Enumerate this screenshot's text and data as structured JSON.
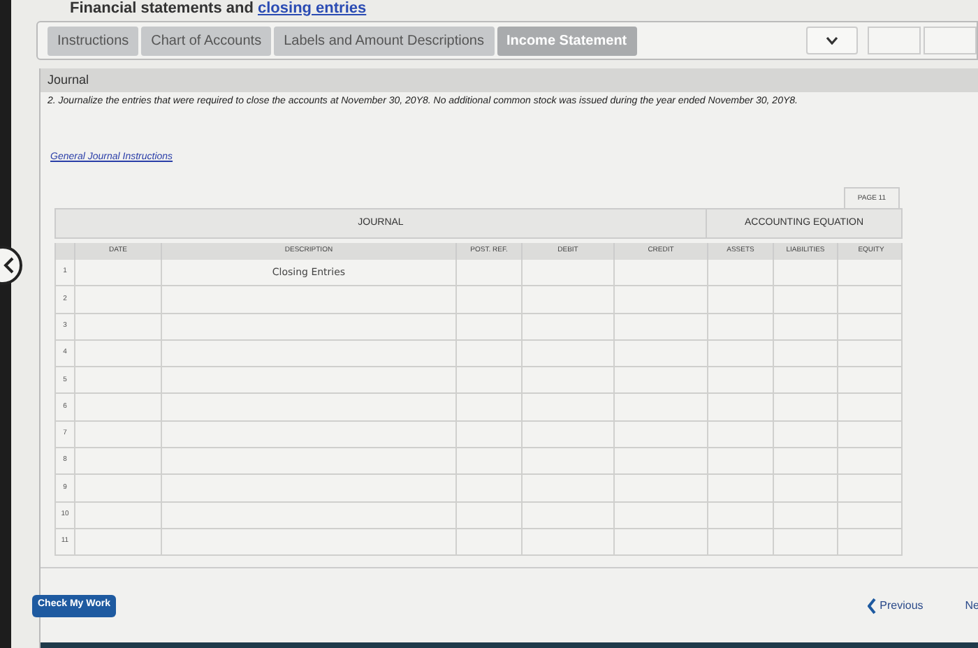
{
  "header": {
    "title": "Financial statements and",
    "link": "closing entries"
  },
  "tabs": [
    {
      "label": "Instructions",
      "selected": false
    },
    {
      "label": "Chart of Accounts",
      "selected": false
    },
    {
      "label": "Labels and Amount Descriptions",
      "selected": false
    },
    {
      "label": "Income Statement",
      "selected": true
    }
  ],
  "panel": {
    "title": "Journal",
    "instruction": "2. Journalize the entries that were required to close the accounts at November 30, 20Y8. No additional common stock was issued during the year ended November 30, 20Y8.",
    "link": "General Journal Instructions"
  },
  "journal": {
    "page": "PAGE 11",
    "group_1": "JOURNAL",
    "group_2": "ACCOUNTING EQUATION",
    "columns": [
      "DATE",
      "DESCRIPTION",
      "POST. REF.",
      "DEBIT",
      "CREDIT",
      "ASSETS",
      "LIABILITIES",
      "EQUITY"
    ],
    "rows": [
      {
        "number": "1",
        "description": "Closing Entries"
      },
      {
        "number": "2"
      },
      {
        "number": "3"
      },
      {
        "number": "4"
      },
      {
        "number": "5"
      },
      {
        "number": "6"
      },
      {
        "number": "7"
      },
      {
        "number": "8"
      },
      {
        "number": "9"
      },
      {
        "number": "10"
      },
      {
        "number": "11"
      }
    ]
  },
  "footer": {
    "check_button": "Check My Work",
    "previous": "Previous",
    "next": "Ne"
  }
}
